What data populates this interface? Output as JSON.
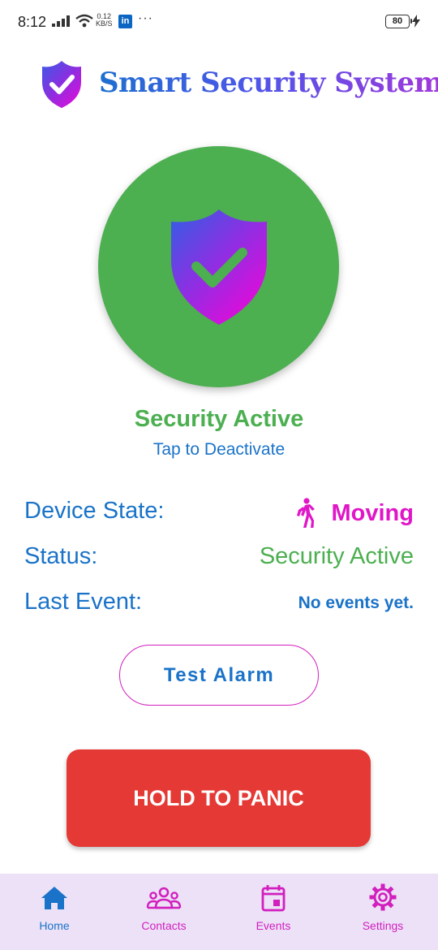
{
  "status_bar": {
    "time": "8:12",
    "speed_value": "0.12",
    "speed_unit": "KB/S",
    "notification_icon": "in",
    "more": "···",
    "battery": "80"
  },
  "header": {
    "title": "Smart Security System",
    "logo_icon": "shield-check-icon"
  },
  "status": {
    "title": "Security Active",
    "subtitle": "Tap to Deactivate",
    "color": "#4caf50"
  },
  "info": {
    "device_state_label": "Device State:",
    "device_state_value": "Moving",
    "device_state_icon": "walking-person-icon",
    "status_label": "Status:",
    "status_value": "Security Active",
    "last_event_label": "Last Event:",
    "last_event_value": "No events yet."
  },
  "buttons": {
    "test_alarm": "Test Alarm",
    "panic": "HOLD TO PANIC"
  },
  "nav": {
    "home": "Home",
    "contacts": "Contacts",
    "events": "Events",
    "settings": "Settings"
  },
  "colors": {
    "primary_blue": "#1a73c8",
    "accent_magenta": "#d21fbe",
    "active_green": "#4caf50",
    "panic_red": "#e53935",
    "nav_background": "#ece1f7"
  }
}
